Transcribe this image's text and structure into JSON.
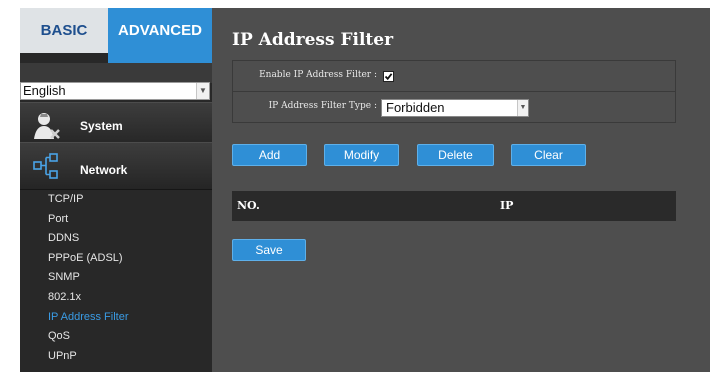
{
  "tabs": {
    "basic": "BASIC",
    "advanced": "ADVANCED"
  },
  "language": {
    "selected": "English"
  },
  "sidebar": {
    "sections": {
      "system": "System",
      "network": "Network"
    },
    "items": [
      {
        "label": "TCP/IP",
        "active": false
      },
      {
        "label": "Port",
        "active": false
      },
      {
        "label": "DDNS",
        "active": false
      },
      {
        "label": "PPPoE (ADSL)",
        "active": false
      },
      {
        "label": "SNMP",
        "active": false
      },
      {
        "label": "802.1x",
        "active": false
      },
      {
        "label": "IP Address Filter",
        "active": true
      },
      {
        "label": "QoS",
        "active": false
      },
      {
        "label": "UPnP",
        "active": false
      }
    ]
  },
  "main": {
    "title": "IP Address Filter",
    "enable_label": "Enable IP Address Filter :",
    "enable_checked": true,
    "type_label": "IP Address Filter Type :",
    "type_value": "Forbidden",
    "buttons": {
      "add": "Add",
      "modify": "Modify",
      "delete": "Delete",
      "clear": "Clear",
      "save": "Save"
    },
    "table": {
      "columns": [
        "NO.",
        "IP"
      ]
    }
  },
  "colors": {
    "accent": "#2f8fd6",
    "sidebar_bg": "#282828",
    "main_bg": "#4e4e4e",
    "active_link": "#3a9be4"
  }
}
